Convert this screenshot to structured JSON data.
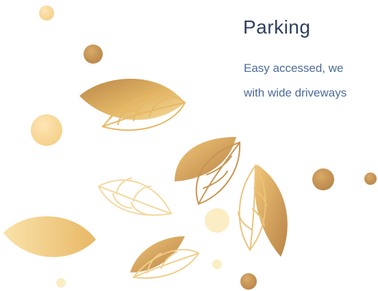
{
  "feature": {
    "title": "Parking",
    "description_lines": [
      "Easy accessed, we",
      "with wide driveways"
    ]
  },
  "colors": {
    "title": "#2f3f5e",
    "text": "#4b6a9b",
    "gold_light": "#f7dda0",
    "gold_mid": "#e6b763",
    "gold_dark": "#b98548",
    "pale": "#fbedc4"
  },
  "decoration": {
    "icon": "gold-leaves-and-dots-illustration"
  }
}
